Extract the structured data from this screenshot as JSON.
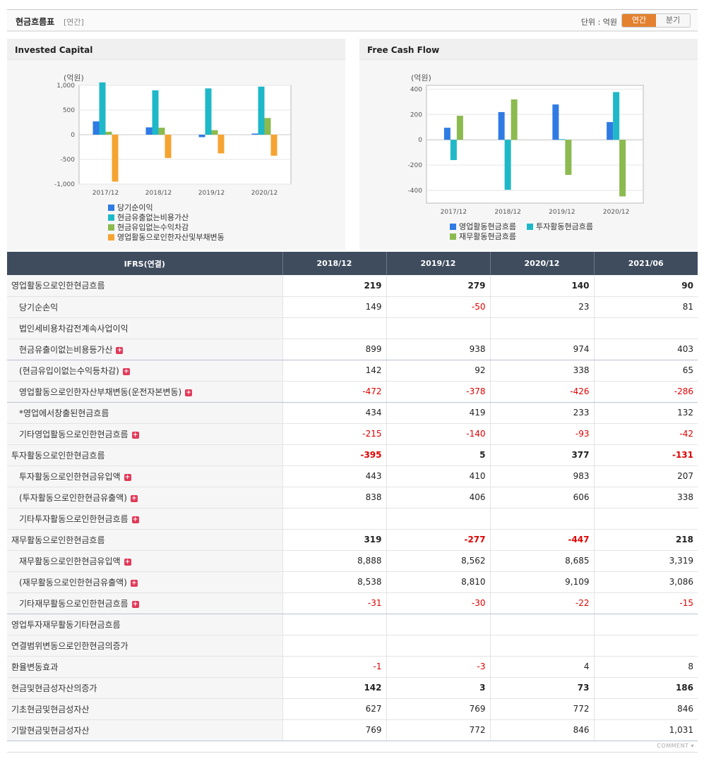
{
  "header": {
    "title": "현금흐름표",
    "subtitle": "[연간]",
    "unit_label": "단위 : 억원",
    "toggle": {
      "annual": "연간",
      "quarterly": "분기"
    }
  },
  "colors": {
    "blue": "#2f7be3",
    "teal": "#1fb8c8",
    "green": "#8cba4f",
    "orange": "#f5a431",
    "header_bg": "#3e4c5e",
    "accent": "#e3812f",
    "negative": "#e00000"
  },
  "chart_data": [
    {
      "type": "bar",
      "title": "Invested Capital",
      "ylabel": "(억원)",
      "categories": [
        "2017/12",
        "2018/12",
        "2019/12",
        "2020/12"
      ],
      "ylim": [
        -1000,
        1000
      ],
      "yticks": [
        -1000,
        -500,
        0,
        500,
        1000
      ],
      "ytick_labels": [
        "-1,000",
        "-500",
        "0",
        "500",
        "1,000"
      ],
      "legend_position": "bottom",
      "series": [
        {
          "name": "당기순이익",
          "color": "#2f7be3",
          "values": [
            270,
            149,
            -50,
            23
          ]
        },
        {
          "name": "현금유출없는비용가산",
          "color": "#1fb8c8",
          "values": [
            1060,
            899,
            938,
            974
          ]
        },
        {
          "name": "현금유입없는수익차감",
          "color": "#8cba4f",
          "values": [
            60,
            142,
            92,
            338
          ]
        },
        {
          "name": "영업활동으로인한자산및부채변동",
          "color": "#f5a431",
          "values": [
            -950,
            -472,
            -378,
            -426
          ]
        }
      ]
    },
    {
      "type": "bar",
      "title": "Free Cash Flow",
      "ylabel": "(억원)",
      "categories": [
        "2017/12",
        "2018/12",
        "2019/12",
        "2020/12"
      ],
      "ylim": [
        -500,
        430
      ],
      "yticks": [
        -400,
        -200,
        0,
        200,
        400
      ],
      "ytick_labels": [
        "-400",
        "-200",
        "0",
        "200",
        "400"
      ],
      "legend_position": "bottom",
      "series": [
        {
          "name": "영업활동현금흐름",
          "color": "#2f7be3",
          "values": [
            95,
            219,
            279,
            140
          ]
        },
        {
          "name": "투자활동현금흐름",
          "color": "#1fb8c8",
          "values": [
            -160,
            -395,
            5,
            377
          ]
        },
        {
          "name": "재무활동현금흐름",
          "color": "#8cba4f",
          "values": [
            190,
            319,
            -277,
            -447
          ]
        }
      ]
    }
  ],
  "table": {
    "header_label": "IFRS(연결)",
    "columns": [
      "2018/12",
      "2019/12",
      "2020/12",
      "2021/06"
    ],
    "rows": [
      {
        "label": "영업활동으로인한현금흐름",
        "values": [
          "219",
          "279",
          "140",
          "90"
        ],
        "bold": true,
        "sub": false,
        "plus": false,
        "group": false
      },
      {
        "label": "당기순손익",
        "values": [
          "149",
          "-50",
          "23",
          "81"
        ],
        "bold": false,
        "sub": true,
        "plus": false,
        "group": false
      },
      {
        "label": "법인세비용차감전계속사업이익",
        "values": [
          "",
          "",
          "",
          ""
        ],
        "bold": false,
        "sub": true,
        "plus": false,
        "group": false
      },
      {
        "label": "현금유출이없는비용등가산",
        "values": [
          "899",
          "938",
          "974",
          "403"
        ],
        "bold": false,
        "sub": true,
        "plus": true,
        "group": true
      },
      {
        "label": "(현금유입이없는수익등차감)",
        "values": [
          "142",
          "92",
          "338",
          "65"
        ],
        "bold": false,
        "sub": true,
        "plus": true,
        "group": false
      },
      {
        "label": "영업활동으로인한자산부채변동(운전자본변동)",
        "values": [
          "-472",
          "-378",
          "-426",
          "-286"
        ],
        "bold": false,
        "sub": true,
        "plus": true,
        "group": true
      },
      {
        "label": "*영업에서창출된현금흐름",
        "values": [
          "434",
          "419",
          "233",
          "132"
        ],
        "bold": false,
        "sub": true,
        "plus": false,
        "group": false
      },
      {
        "label": "기타영업활동으로인한현금흐름",
        "values": [
          "-215",
          "-140",
          "-93",
          "-42"
        ],
        "bold": false,
        "sub": true,
        "plus": true,
        "group": false
      },
      {
        "label": "투자활동으로인한현금흐름",
        "values": [
          "-395",
          "5",
          "377",
          "-131"
        ],
        "bold": true,
        "sub": false,
        "plus": false,
        "group": false
      },
      {
        "label": "투자활동으로인한현금유입액",
        "values": [
          "443",
          "410",
          "983",
          "207"
        ],
        "bold": false,
        "sub": true,
        "plus": true,
        "group": false
      },
      {
        "label": "(투자활동으로인한현금유출액)",
        "values": [
          "838",
          "406",
          "606",
          "338"
        ],
        "bold": false,
        "sub": true,
        "plus": true,
        "group": false
      },
      {
        "label": "기타투자활동으로인한현금흐름",
        "values": [
          "",
          "",
          "",
          ""
        ],
        "bold": false,
        "sub": true,
        "plus": true,
        "group": false
      },
      {
        "label": "재무활동으로인한현금흐름",
        "values": [
          "319",
          "-277",
          "-447",
          "218"
        ],
        "bold": true,
        "sub": false,
        "plus": false,
        "group": false
      },
      {
        "label": "재무활동으로인한현금유입액",
        "values": [
          "8,888",
          "8,562",
          "8,685",
          "3,319"
        ],
        "bold": false,
        "sub": true,
        "plus": true,
        "group": false
      },
      {
        "label": "(재무활동으로인한현금유출액)",
        "values": [
          "8,538",
          "8,810",
          "9,109",
          "3,086"
        ],
        "bold": false,
        "sub": true,
        "plus": true,
        "group": false
      },
      {
        "label": "기타재무활동으로인한현금흐름",
        "values": [
          "-31",
          "-30",
          "-22",
          "-15"
        ],
        "bold": false,
        "sub": true,
        "plus": true,
        "group": true
      },
      {
        "label": "영업투자재무활동기타현금흐름",
        "values": [
          "",
          "",
          "",
          ""
        ],
        "bold": false,
        "sub": false,
        "plus": false,
        "group": false
      },
      {
        "label": "연결범위변동으로인한현금의증가",
        "values": [
          "",
          "",
          "",
          ""
        ],
        "bold": false,
        "sub": false,
        "plus": false,
        "group": false
      },
      {
        "label": "환율변동효과",
        "values": [
          "-1",
          "-3",
          "4",
          "8"
        ],
        "bold": false,
        "sub": false,
        "plus": false,
        "group": false
      },
      {
        "label": "현금및현금성자산의증가",
        "values": [
          "142",
          "3",
          "73",
          "186"
        ],
        "bold": true,
        "sub": false,
        "plus": false,
        "group": false
      },
      {
        "label": "기초현금및현금성자산",
        "values": [
          "627",
          "769",
          "772",
          "846"
        ],
        "bold": false,
        "sub": false,
        "plus": false,
        "group": false
      },
      {
        "label": "기말현금및현금성자산",
        "values": [
          "769",
          "772",
          "846",
          "1,031"
        ],
        "bold": false,
        "sub": false,
        "plus": false,
        "group": true
      }
    ]
  },
  "footer": {
    "comment_label": "COMMENT ▾"
  }
}
